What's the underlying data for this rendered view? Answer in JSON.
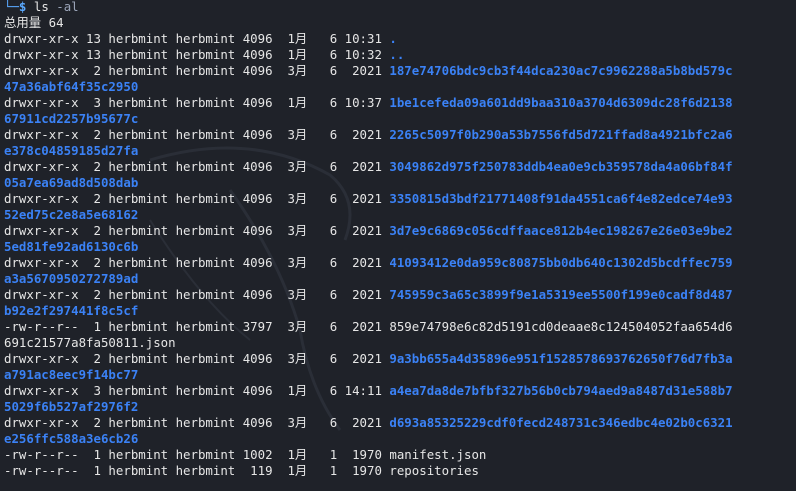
{
  "prompt": {
    "prefix": "└─",
    "symbol": "$",
    "command": "ls",
    "args": "-al"
  },
  "total_line": "总用量 64",
  "entries": [
    {
      "meta": "drwxr-xr-x 13 herbmint herbmint 4096  1月   6 10:31 ",
      "name_1": ".",
      "name_2": "",
      "type": "dir"
    },
    {
      "meta": "drwxr-xr-x 13 herbmint herbmint 4096  1月   6 10:32 ",
      "name_1": "..",
      "name_2": "",
      "type": "dir"
    },
    {
      "meta": "drwxr-xr-x  2 herbmint herbmint 4096  3月   6  2021 ",
      "name_1": "187e74706bdc9cb3f44dca230ac7c9962288a5b8bd579c",
      "name_2": "47a36abf64f35c2950",
      "type": "dir"
    },
    {
      "meta": "drwxr-xr-x  3 herbmint herbmint 4096  1月   6 10:37 ",
      "name_1": "1be1cefeda09a601dd9baa310a3704d6309dc28f6d2138",
      "name_2": "67911cd2257b95677c",
      "type": "dir"
    },
    {
      "meta": "drwxr-xr-x  2 herbmint herbmint 4096  3月   6  2021 ",
      "name_1": "2265c5097f0b290a53b7556fd5d721ffad8a4921bfc2a6",
      "name_2": "e378c04859185d27fa",
      "type": "dir"
    },
    {
      "meta": "drwxr-xr-x  2 herbmint herbmint 4096  3月   6  2021 ",
      "name_1": "3049862d975f250783ddb4ea0e9cb359578da4a06bf84f",
      "name_2": "05a7ea69ad8d508dab",
      "type": "dir"
    },
    {
      "meta": "drwxr-xr-x  2 herbmint herbmint 4096  3月   6  2021 ",
      "name_1": "3350815d3bdf21771408f91da4551ca6f4e82edce74e93",
      "name_2": "52ed75c2e8a5e68162",
      "type": "dir"
    },
    {
      "meta": "drwxr-xr-x  2 herbmint herbmint 4096  3月   6  2021 ",
      "name_1": "3d7e9c6869c056cdffaace812b4ec198267e26e03e9be2",
      "name_2": "5ed81fe92ad6130c6b",
      "type": "dir"
    },
    {
      "meta": "drwxr-xr-x  2 herbmint herbmint 4096  3月   6  2021 ",
      "name_1": "41093412e0da959c80875bb0db640c1302d5bcdffec759",
      "name_2": "a3a5670950272789ad",
      "type": "dir"
    },
    {
      "meta": "drwxr-xr-x  2 herbmint herbmint 4096  3月   6  2021 ",
      "name_1": "745959c3a65c3899f9e1a5319ee5500f199e0cadf8d487",
      "name_2": "b92e2f297441f8c5cf",
      "type": "dir"
    },
    {
      "meta": "-rw-r--r--  1 herbmint herbmint 3797  3月   6  2021 ",
      "name_1": "859e74798e6c82d5191cd0deaae8c124504052faa654d6",
      "name_2": "691c21577a8fa50811.json",
      "type": "file"
    },
    {
      "meta": "drwxr-xr-x  2 herbmint herbmint 4096  3月   6  2021 ",
      "name_1": "9a3bb655a4d35896e951f1528578693762650f76d7fb3a",
      "name_2": "a791ac8eec9f14bc77",
      "type": "dir"
    },
    {
      "meta": "drwxr-xr-x  3 herbmint herbmint 4096  1月   6 14:11 ",
      "name_1": "a4ea7da8de7bfbf327b56b0cb794aed9a8487d31e588b7",
      "name_2": "5029f6b527af2976f2",
      "type": "dir"
    },
    {
      "meta": "drwxr-xr-x  2 herbmint herbmint 4096  3月   6  2021 ",
      "name_1": "d693a85325229cdf0fecd248731c346edbc4e02b0c6321",
      "name_2": "e256ffc588a3e6cb26",
      "type": "dir"
    },
    {
      "meta": "-rw-r--r--  1 herbmint herbmint 1002  1月   1  1970 ",
      "name_1": "manifest.json",
      "name_2": "",
      "type": "file"
    },
    {
      "meta": "-rw-r--r--  1 herbmint herbmint  119  1月   1  1970 ",
      "name_1": "repositories",
      "name_2": "",
      "type": "file"
    }
  ]
}
